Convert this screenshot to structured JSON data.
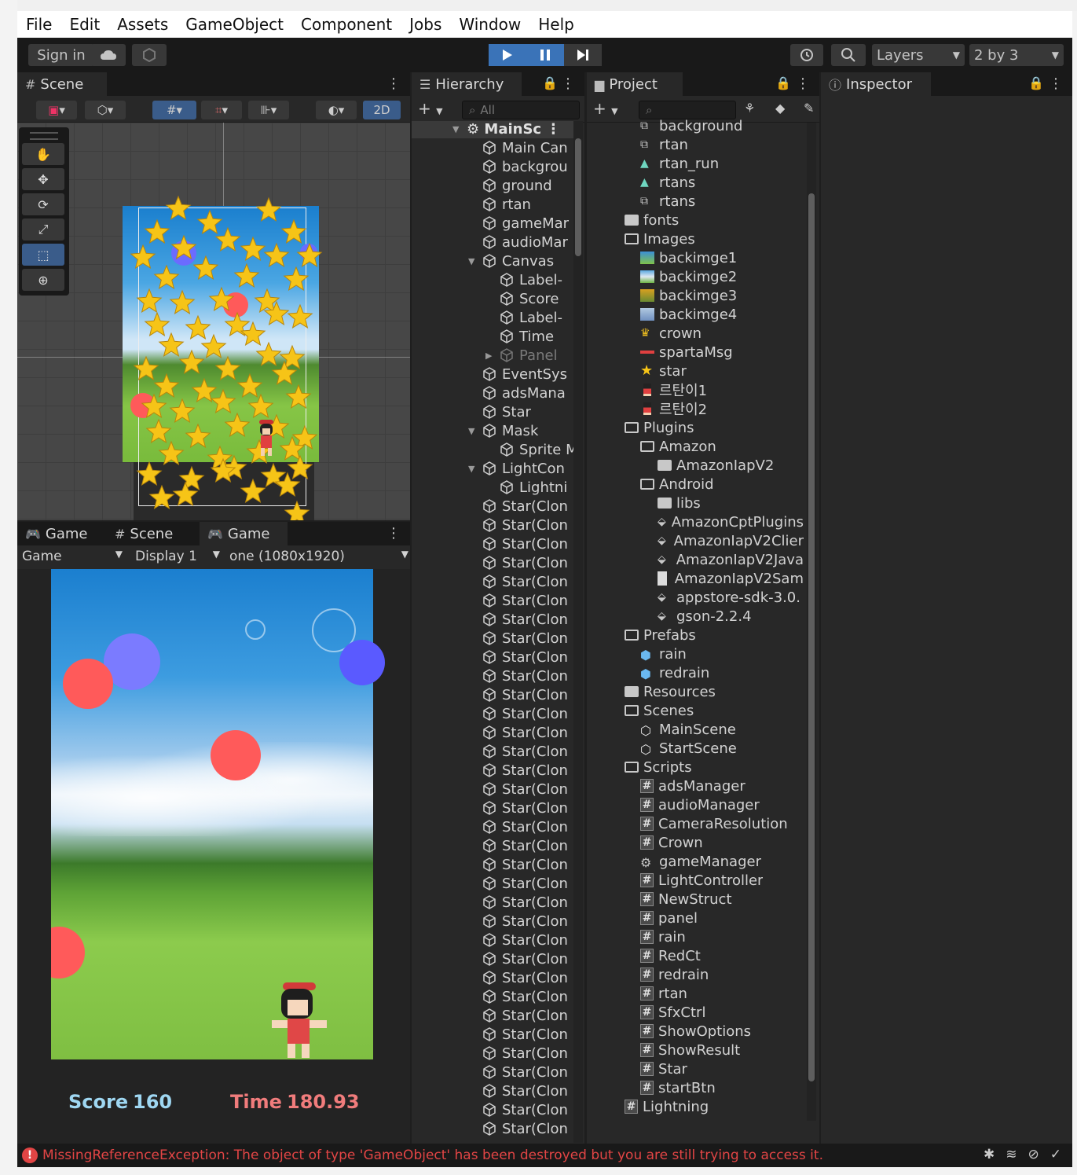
{
  "menu": [
    "File",
    "Edit",
    "Assets",
    "GameObject",
    "Component",
    "Jobs",
    "Window",
    "Help"
  ],
  "toolbar": {
    "sign_in": "Sign in",
    "layers": "Layers",
    "layout": "2 by 3"
  },
  "scene_panel": {
    "tab": "Scene",
    "mode_2d": "2D"
  },
  "game_panel": {
    "tabs": [
      "Game",
      "Scene",
      "Game"
    ],
    "view_select": "Game",
    "display_select": "Display 1",
    "resolution_select": "one (1080x1920)",
    "score_label": "Score",
    "score_value": "160",
    "time_label": "Time",
    "time_value": "180.93"
  },
  "hierarchy": {
    "tab": "Hierarchy",
    "search_placeholder": "All",
    "scene_name": "MainSc",
    "items": [
      {
        "label": "Main Can",
        "level": 1
      },
      {
        "label": "backgrou",
        "level": 1
      },
      {
        "label": "ground",
        "level": 1
      },
      {
        "label": "rtan",
        "level": 1
      },
      {
        "label": "gameMar",
        "level": 1
      },
      {
        "label": "audioMar",
        "level": 1
      },
      {
        "label": "Canvas",
        "level": 1,
        "expanded": true
      },
      {
        "label": "Label-",
        "level": 2
      },
      {
        "label": "Score",
        "level": 2
      },
      {
        "label": "Label-",
        "level": 2
      },
      {
        "label": "Time",
        "level": 2
      },
      {
        "label": "Panel",
        "level": 2,
        "dim": true,
        "collapsed": true
      },
      {
        "label": "EventSys",
        "level": 1
      },
      {
        "label": "adsMana",
        "level": 1
      },
      {
        "label": "Star",
        "level": 1
      },
      {
        "label": "Mask",
        "level": 1,
        "expanded": true
      },
      {
        "label": "Sprite M",
        "level": 2
      },
      {
        "label": "LightCon",
        "level": 1,
        "expanded": true
      },
      {
        "label": "Lightni",
        "level": 2
      }
    ],
    "clone_label": "Star(Clon",
    "clone_count": 34
  },
  "project": {
    "tab": "Project",
    "items": [
      {
        "label": "background",
        "level": 2,
        "icon": "anim"
      },
      {
        "label": "rtan",
        "level": 2,
        "icon": "anim"
      },
      {
        "label": "rtan_run",
        "level": 2,
        "icon": "clip"
      },
      {
        "label": "rtans",
        "level": 2,
        "icon": "clip"
      },
      {
        "label": "rtans",
        "level": 2,
        "icon": "anim"
      },
      {
        "label": "fonts",
        "level": 1,
        "icon": "folder",
        "arrow": "right"
      },
      {
        "label": "Images",
        "level": 1,
        "icon": "folder-open",
        "arrow": "down"
      },
      {
        "label": "backimge1",
        "level": 2,
        "icon": "img1",
        "arrow": "right"
      },
      {
        "label": "backimge2",
        "level": 2,
        "icon": "img2",
        "arrow": "right"
      },
      {
        "label": "backimge3",
        "level": 2,
        "icon": "img3",
        "arrow": "right"
      },
      {
        "label": "backimge4",
        "level": 2,
        "icon": "img4",
        "arrow": "right"
      },
      {
        "label": "crown",
        "level": 2,
        "icon": "crown",
        "arrow": "right"
      },
      {
        "label": "spartaMsg",
        "level": 2,
        "icon": "msg",
        "arrow": "right"
      },
      {
        "label": "star",
        "level": 2,
        "icon": "star",
        "arrow": "right"
      },
      {
        "label": "르탄이1",
        "level": 2,
        "icon": "char",
        "arrow": "right"
      },
      {
        "label": "르탄이2",
        "level": 2,
        "icon": "char",
        "arrow": "right"
      },
      {
        "label": "Plugins",
        "level": 1,
        "icon": "folder-open",
        "arrow": "down"
      },
      {
        "label": "Amazon",
        "level": 2,
        "icon": "folder-open",
        "arrow": "down"
      },
      {
        "label": "AmazonIapV2",
        "level": 3,
        "icon": "folder",
        "arrow": "right"
      },
      {
        "label": "Android",
        "level": 2,
        "icon": "folder-open",
        "arrow": "down"
      },
      {
        "label": "libs",
        "level": 3,
        "icon": "folder",
        "arrow": "right"
      },
      {
        "label": "AmazonCptPlugins",
        "level": 3,
        "icon": "plugin"
      },
      {
        "label": "AmazonIapV2Clier",
        "level": 3,
        "icon": "plugin"
      },
      {
        "label": "AmazonIapV2Java",
        "level": 3,
        "icon": "plugin"
      },
      {
        "label": "AmazonIapV2Sam",
        "level": 3,
        "icon": "doc"
      },
      {
        "label": "appstore-sdk-3.0.",
        "level": 3,
        "icon": "plugin"
      },
      {
        "label": "gson-2.2.4",
        "level": 3,
        "icon": "plugin"
      },
      {
        "label": "Prefabs",
        "level": 1,
        "icon": "folder-open",
        "arrow": "down"
      },
      {
        "label": "rain",
        "level": 2,
        "icon": "prefab"
      },
      {
        "label": "redrain",
        "level": 2,
        "icon": "prefab"
      },
      {
        "label": "Resources",
        "level": 1,
        "icon": "folder",
        "arrow": "right"
      },
      {
        "label": "Scenes",
        "level": 1,
        "icon": "folder-open",
        "arrow": "down"
      },
      {
        "label": "MainScene",
        "level": 2,
        "icon": "unity"
      },
      {
        "label": "StartScene",
        "level": 2,
        "icon": "unity"
      },
      {
        "label": "Scripts",
        "level": 1,
        "icon": "folder-open",
        "arrow": "down"
      },
      {
        "label": "adsManager",
        "level": 2,
        "icon": "script"
      },
      {
        "label": "audioManager",
        "level": 2,
        "icon": "script"
      },
      {
        "label": "CameraResolution",
        "level": 2,
        "icon": "script"
      },
      {
        "label": "Crown",
        "level": 2,
        "icon": "script"
      },
      {
        "label": "gameManager",
        "level": 2,
        "icon": "gear"
      },
      {
        "label": "LightController",
        "level": 2,
        "icon": "script"
      },
      {
        "label": "NewStruct",
        "level": 2,
        "icon": "script"
      },
      {
        "label": "panel",
        "level": 2,
        "icon": "script"
      },
      {
        "label": "rain",
        "level": 2,
        "icon": "script"
      },
      {
        "label": "RedCt",
        "level": 2,
        "icon": "script"
      },
      {
        "label": "redrain",
        "level": 2,
        "icon": "script"
      },
      {
        "label": "rtan",
        "level": 2,
        "icon": "script"
      },
      {
        "label": "SfxCtrl",
        "level": 2,
        "icon": "script"
      },
      {
        "label": "ShowOptions",
        "level": 2,
        "icon": "script"
      },
      {
        "label": "ShowResult",
        "level": 2,
        "icon": "script"
      },
      {
        "label": "Star",
        "level": 2,
        "icon": "script"
      },
      {
        "label": "startBtn",
        "level": 2,
        "icon": "script"
      },
      {
        "label": "Lightning",
        "level": 1,
        "icon": "script"
      }
    ]
  },
  "inspector": {
    "tab": "Inspector"
  },
  "status": {
    "message": "MissingReferenceException: The object of type 'GameObject' has been destroyed but you are still trying to access it."
  },
  "colors": {
    "accent": "#3a73b8",
    "error": "#e24545",
    "score": "#9fd7f2",
    "time": "#f07c7c"
  }
}
